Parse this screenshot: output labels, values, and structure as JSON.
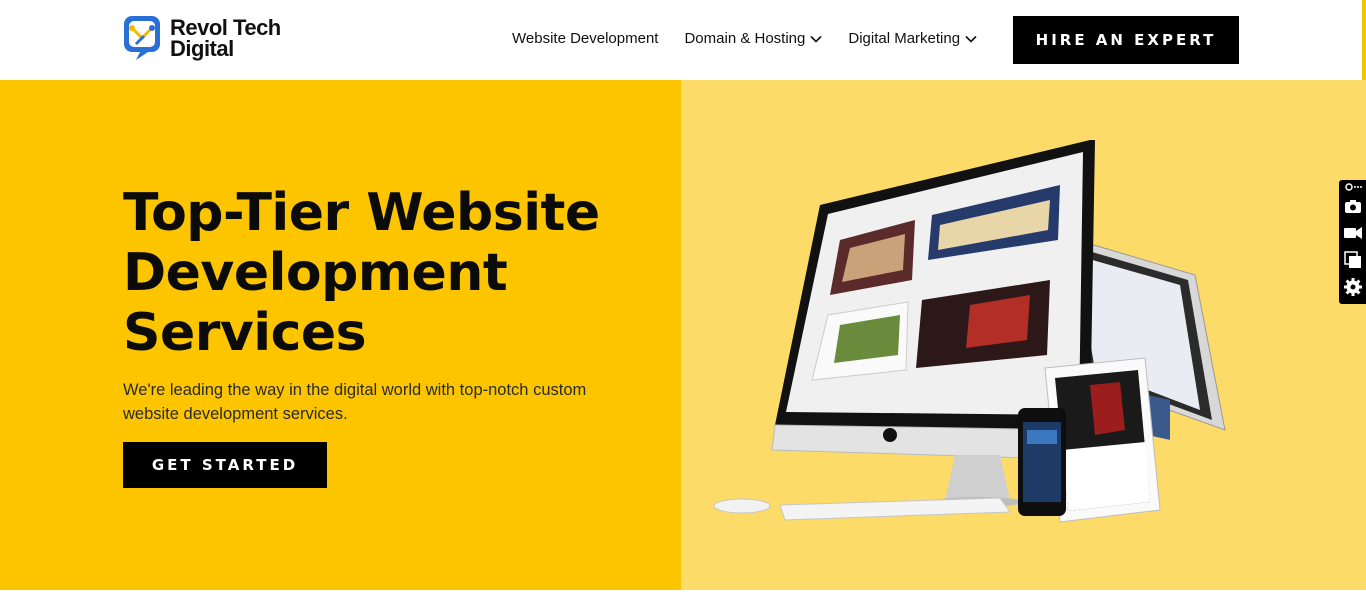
{
  "brand": {
    "name_line1": "Revol Tech",
    "name_line2": "Digital",
    "colors": {
      "primary": "#fdc500",
      "secondary": "#fddb68",
      "dark": "#000000",
      "logo_blue": "#2a6fd6",
      "logo_yellow": "#f5b800"
    }
  },
  "nav": {
    "items": [
      {
        "label": "Website Development",
        "has_dropdown": false
      },
      {
        "label": "Domain & Hosting",
        "has_dropdown": true,
        "icon": "chevron-down-icon"
      },
      {
        "label": "Digital Marketing",
        "has_dropdown": true,
        "icon": "chevron-down-icon"
      }
    ],
    "cta_label": "HIRE AN EXPERT"
  },
  "hero": {
    "title_line1": "Top-Tier Website",
    "title_line2": "Development",
    "title_line3": "Services",
    "subtitle": "We're leading the way in the digital world with top-notch custom website development services.",
    "cta_label": "GET STARTED",
    "image": "responsive-devices-illustration"
  },
  "side_toolbar": {
    "tools": [
      "link-icon",
      "camera-icon",
      "video-icon",
      "copy-icon",
      "gear-icon"
    ]
  }
}
